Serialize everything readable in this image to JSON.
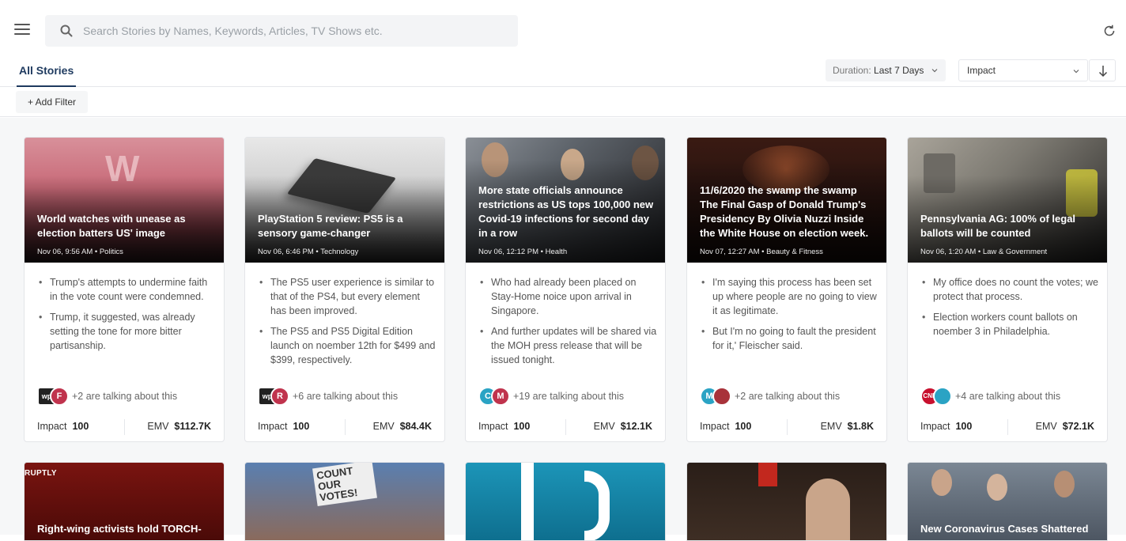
{
  "search": {
    "placeholder": "Search Stories by Names, Keywords, Articles, TV Shows etc."
  },
  "tabs": {
    "all_stories": "All Stories"
  },
  "controls": {
    "duration_label": "Duration:",
    "duration_value": "Last 7 Days",
    "sort_value": "Impact",
    "add_filter": "+ Add Filter"
  },
  "cards": [
    {
      "headline": "World watches with unease as election batters US' image",
      "meta": "Nov 06, 9:56 AM  • Politics",
      "bullets": [
        "Trump's attempts to undermine faith in the vote count were condemned.",
        "Trump, it suggested, was already setting the tone for more bitter partisanship."
      ],
      "avatars": [
        "wp",
        "F"
      ],
      "talking": "+2 are talking about this",
      "impact_label": "Impact",
      "impact": "100",
      "emv_label": "EMV",
      "emv": "$112.7K"
    },
    {
      "headline": "PlayStation 5 review: PS5 is a sensory game-changer",
      "meta": "Nov 06, 6:46 PM  • Technology",
      "bullets": [
        "The PS5 user experience is similar to that of the PS4, but every element has been improved.",
        "The PS5 and PS5 Digital Edition launch on noember 12th for $499 and $399, respectively."
      ],
      "avatars": [
        "wp",
        "R"
      ],
      "talking": "+6 are talking about this",
      "impact_label": "Impact",
      "impact": "100",
      "emv_label": "EMV",
      "emv": "$84.4K"
    },
    {
      "headline": "More state officials announce restrictions as US tops 100,000 new Covid-19 infections for second day in a row",
      "meta": "Nov 06, 12:12 PM  • Health",
      "bullets": [
        "Who had already been placed on Stay-Home noice upon arrival in Singapore.",
        "And further updates will be shared via the MOH press release that will be issued tonight."
      ],
      "avatars": [
        "C",
        "M"
      ],
      "talking": "+19 are talking about this",
      "impact_label": "Impact",
      "impact": "100",
      "emv_label": "EMV",
      "emv": "$12.1K"
    },
    {
      "headline": "11/6/2020 the swamp the swamp The Final Gasp of Donald Trump's Presidency By Olivia Nuzzi Inside the White House on election week.",
      "meta": "Nov 07, 12:27 AM  • Beauty & Fitness",
      "bullets": [
        "I'm saying this process has been set up where people are no going to view it as legitimate.",
        "But I'm no going to fault the president for it,' Fleischer said."
      ],
      "avatars": [
        "M",
        ""
      ],
      "talking": "+2 are talking about this",
      "impact_label": "Impact",
      "impact": "100",
      "emv_label": "EMV",
      "emv": "$1.8K"
    },
    {
      "headline": "Pennsylvania AG: 100% of legal ballots will be counted",
      "meta": "Nov 06, 1:20 AM  • Law & Government",
      "bullets": [
        "My office does no count the votes; we protect that process.",
        "Election workers count ballots on noember 3 in Philadelphia."
      ],
      "avatars": [
        "CNN",
        ""
      ],
      "talking": "+4 are talking about this",
      "impact_label": "Impact",
      "impact": "100",
      "emv_label": "EMV",
      "emv": "$72.1K"
    }
  ],
  "row2": [
    {
      "headline": "Right-wing activists hold TORCH-",
      "source_badge": "RUPTLY"
    },
    {
      "headline": "",
      "sign_text": "COUNT OUR VOTES!"
    },
    {
      "headline": ""
    },
    {
      "headline": ""
    },
    {
      "headline": "New Coronavirus Cases Shattered"
    }
  ],
  "thumb_letter": "W",
  "colors": {
    "accent": "#1e3a5f",
    "avatar_red": "#c0334d",
    "avatar_teal": "#2aa3c4"
  }
}
